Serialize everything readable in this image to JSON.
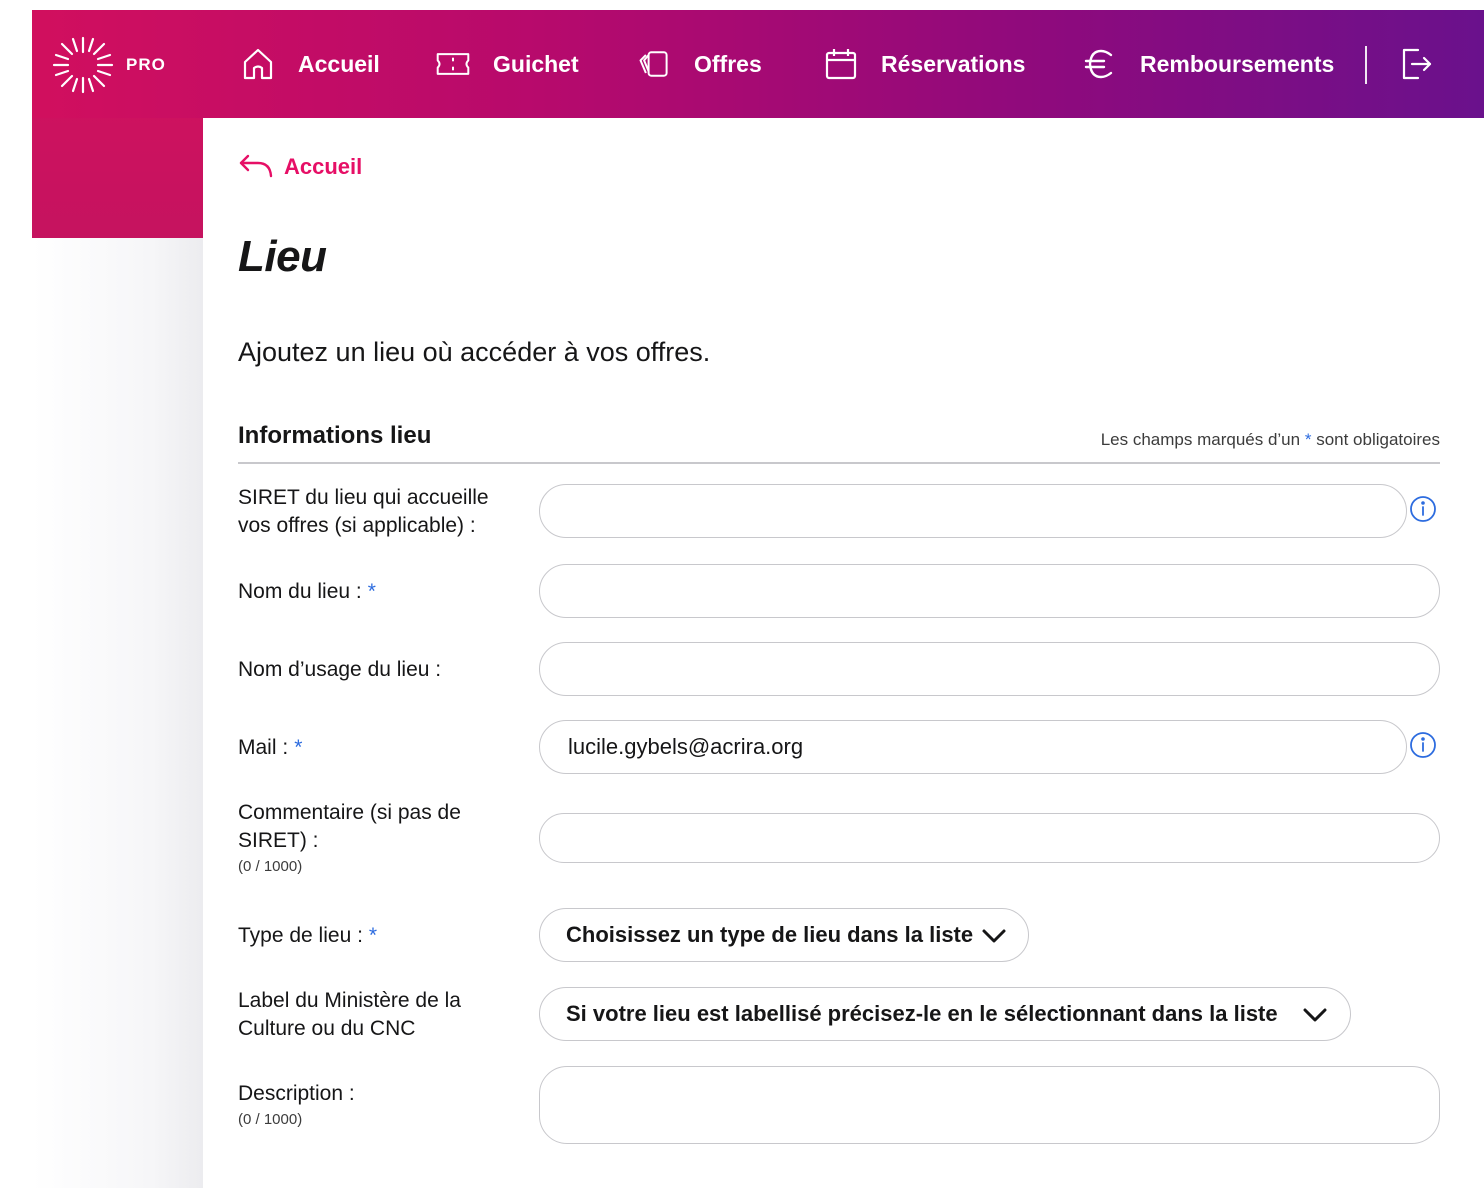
{
  "nav": {
    "brand": "PRO",
    "items": [
      {
        "label": "Accueil",
        "icon": "home-icon"
      },
      {
        "label": "Guichet",
        "icon": "ticket-icon"
      },
      {
        "label": "Offres",
        "icon": "cards-icon"
      },
      {
        "label": "Réservations",
        "icon": "calendar-icon"
      },
      {
        "label": "Remboursements",
        "icon": "euro-icon"
      }
    ],
    "logout_icon": "logout-icon"
  },
  "breadcrumb": {
    "back_label": "Accueil"
  },
  "page": {
    "title": "Lieu",
    "intro": "Ajoutez un lieu où accéder à vos offres."
  },
  "section": {
    "title": "Informations lieu",
    "mandatory_before": "Les champs marqués d’un",
    "mandatory_star": "*",
    "mandatory_after": "sont obligatoires"
  },
  "form": {
    "siret": {
      "label_line1": "SIRET du lieu qui accueille",
      "label_line2": "vos offres (si applicable) :",
      "value": ""
    },
    "name": {
      "label": "Nom du lieu :",
      "star": "*",
      "value": ""
    },
    "public_name": {
      "label": "Nom d’usage du lieu :",
      "value": ""
    },
    "mail": {
      "label": "Mail :",
      "star": "*",
      "value": "lucile.gybels@acrira.org"
    },
    "comment": {
      "label_line1": "Commentaire (si pas de",
      "label_line2": "SIRET) :",
      "count": "(0 / 1000)",
      "value": ""
    },
    "venue_type": {
      "label": "Type de lieu :",
      "star": "*",
      "selected": "Choisissez un type de lieu dans la liste"
    },
    "venue_label": {
      "label_line1": "Label du Ministère de la",
      "label_line2": "Culture ou du CNC",
      "selected": "Si votre lieu est labellisé précisez-le en le sélectionnant dans la liste"
    },
    "description": {
      "label": "Description :",
      "count": "(0 / 1000)",
      "value": ""
    }
  },
  "colors": {
    "accent": "#e60f66",
    "required_star": "#2d6cdf",
    "header_start": "#d10f5e",
    "header_end": "#6a118c"
  }
}
